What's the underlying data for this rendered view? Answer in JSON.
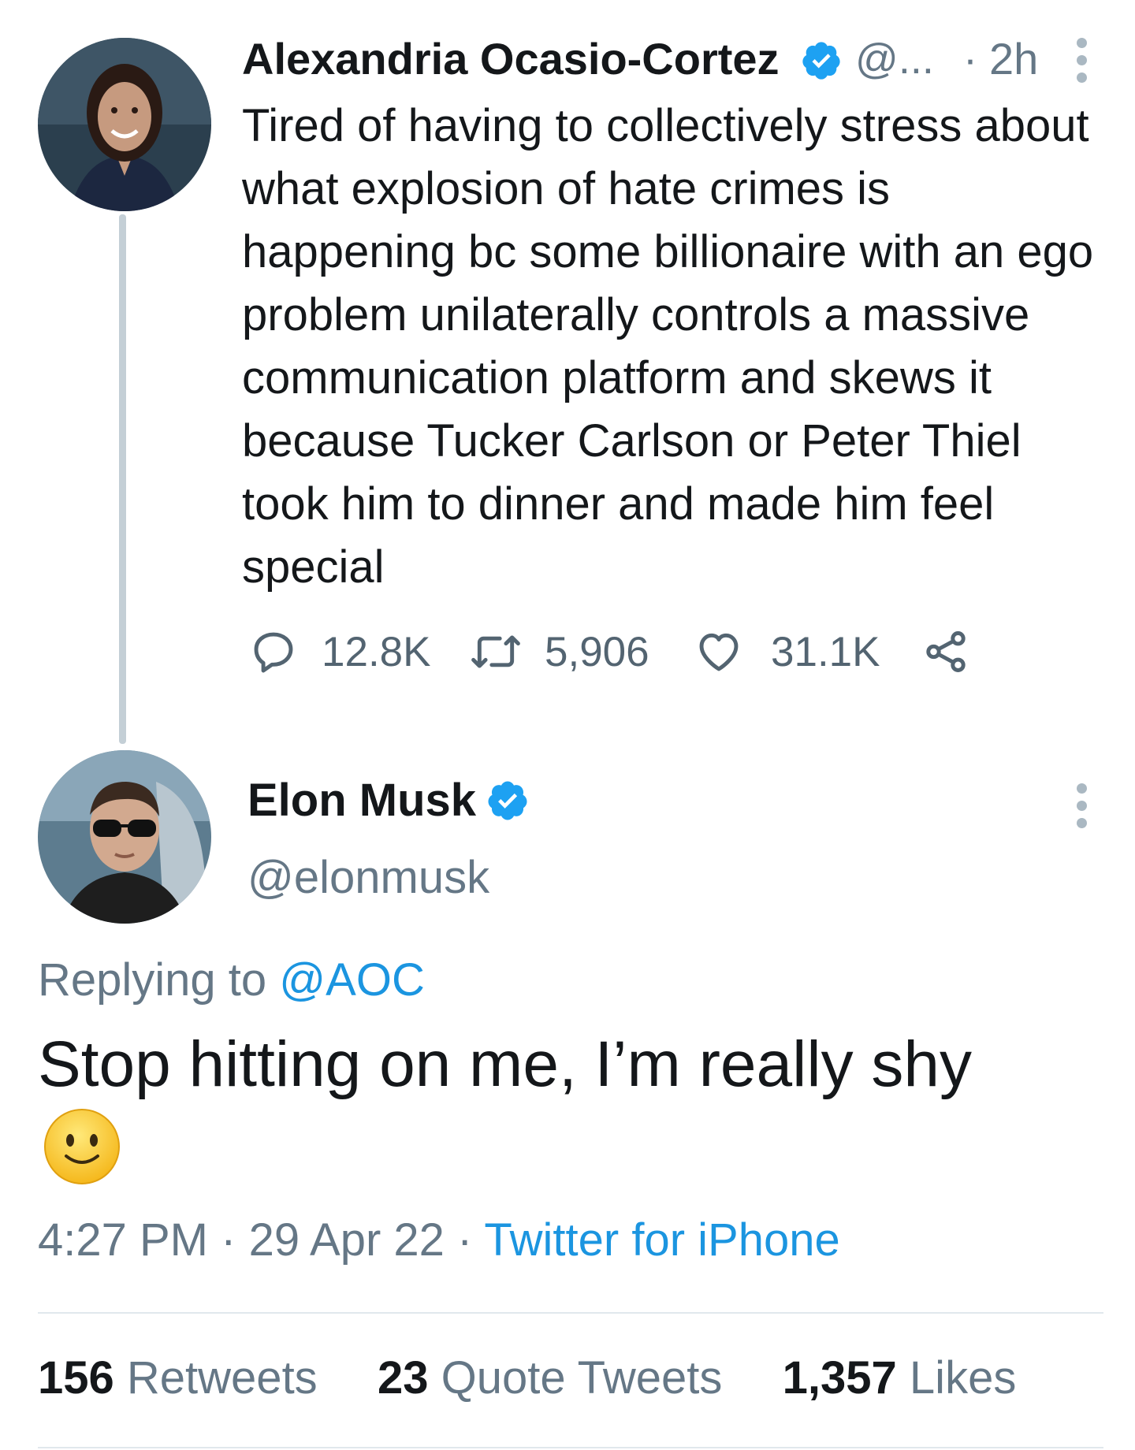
{
  "original_tweet": {
    "author_name": "Alexandria Ocasio-Cortez",
    "handle_truncated": "@...",
    "separator": "·",
    "time_ago": "2h",
    "text": "Tired of having to collectively stress about what explosion of hate crimes is happening bc some billionaire with an ego problem unilaterally controls a massive communication platform and skews it because Tucker Carlson or Peter Thiel took him to dinner and made him feel special",
    "replies": "12.8K",
    "retweets": "5,906",
    "likes": "31.1K"
  },
  "reply_tweet": {
    "author_name": "Elon Musk",
    "handle": "@elonmusk",
    "replying_to_label": "Replying to",
    "replying_to_handle": "@AOC",
    "text": "Stop hitting on me, I’m really shy",
    "emoji": "slightly-smiling-face",
    "time": "4:27 PM",
    "date": "29 Apr 22",
    "separator": "·",
    "source": "Twitter for iPhone",
    "retweets_count": "156",
    "retweets_label": "Retweets",
    "quote_tweets_count": "23",
    "quote_tweets_label": "Quote Tweets",
    "likes_count": "1,357",
    "likes_label": "Likes"
  },
  "colors": {
    "text": "#14171a",
    "muted": "#657786",
    "link": "#1b95e0",
    "verified": "#1da1f2",
    "divider": "#e1e8ed",
    "thread_line": "#c4cfd6"
  },
  "icons": [
    "verified-badge-icon",
    "more-options-icon",
    "reply-icon",
    "retweet-icon",
    "like-icon",
    "share-icon"
  ]
}
